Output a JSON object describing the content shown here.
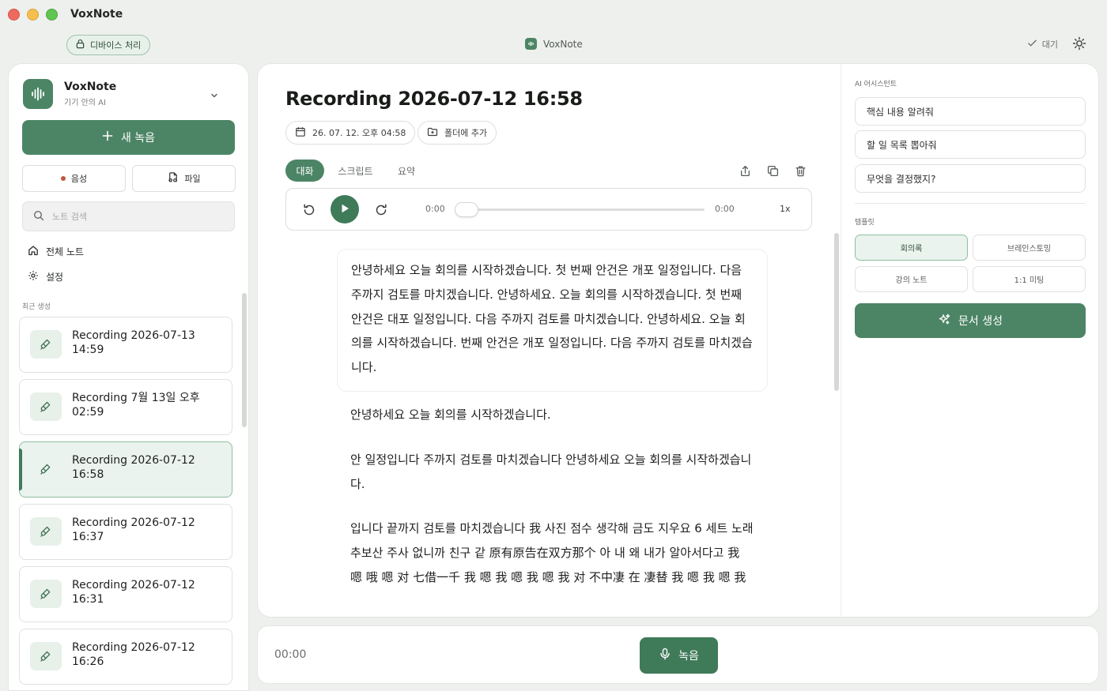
{
  "app": {
    "title": "VoxNote"
  },
  "toolbar": {
    "device_label": "디바이스 처리",
    "center_title": "VoxNote",
    "status_label": "대기"
  },
  "sidebar": {
    "brand_name": "VoxNote",
    "brand_subtitle": "기기 안의 AI",
    "new_recording_label": "새 녹음",
    "voice_label": "음성",
    "file_label": "파일",
    "search_placeholder": "노트 검색",
    "nav": {
      "all_notes": "전체 노트",
      "settings": "설정"
    },
    "section_recent": "최근 생성",
    "recordings": [
      {
        "line1": "Recording 2026-07-13",
        "line2": "14:59"
      },
      {
        "line1": "Recording 7월 13일 오후",
        "line2": "02:59"
      },
      {
        "line1": "Recording 2026-07-12",
        "line2": "16:58"
      },
      {
        "line1": "Recording 2026-07-12",
        "line2": "16:37"
      },
      {
        "line1": "Recording 2026-07-12",
        "line2": "16:31"
      },
      {
        "line1": "Recording 2026-07-12",
        "line2": "16:26"
      }
    ],
    "active_index": 2
  },
  "main": {
    "title": "Recording 2026-07-12 16:58",
    "date_chip": "26. 07. 12. 오후 04:58",
    "folder_chip": "폴더에 추가",
    "tabs": [
      {
        "label": "대화"
      },
      {
        "label": "스크립트"
      },
      {
        "label": "요약"
      }
    ],
    "player": {
      "current_time": "0:00",
      "total_time": "0:00",
      "speed": "1x",
      "progress": 0
    },
    "transcript": [
      "안녕하세요 오늘 회의를 시작하겠습니다. 첫 번째 안건은 개포 일정입니다. 다음 주까지 검토를 마치겠습니다. 안녕하세요. 오늘 회의를 시작하겠습니다. 첫 번째 안건은 대포 일정입니다. 다음 주까지 검토를 마치겠습니다. 안녕하세요. 오늘 회의를 시작하겠습니다. 번째 안건은 개포 일정입니다. 다음 주까지 검토를 마치겠습니다.",
      "안녕하세요 오늘 회의를 시작하겠습니다.",
      "안 일정입니다 주까지 검토를 마치겠습니다 안녕하세요 오늘 회의를 시작하겠습니다.",
      "입니다 끝까지 검토를 마치겠습니다 我 사진 점수 생각해 금도 지우요 6 세트 노래 추보산 주사 없니까 친구 같 原有原告在双方那个 아 내 왜 내가 알아서다고 我 嗯 哦 嗯 对 七借一千 我 嗯 我 嗯 我 嗯 我 对 不中凄 在 凄替 我 嗯 我 嗯 我"
    ]
  },
  "ai_panel": {
    "section_assistant": "AI 어시스턴트",
    "prompts": [
      "핵심 내용 알려줘",
      "할 일 목록 뽑아줘",
      "무엇을 결정했지?"
    ],
    "section_template": "템플릿",
    "templates": [
      "회의록",
      "브레인스토밍",
      "강의 노트",
      "1:1 미팅"
    ],
    "selected_template": "회의록",
    "generate_label": "문서 생성"
  },
  "bottom_bar": {
    "timer": "00:00",
    "record_label": "녹음"
  },
  "colors": {
    "accent": "#4c8566",
    "accent_dark": "#3f7a59",
    "selected_bg": "#eaf3ed",
    "record_dot": "#c2553e"
  }
}
